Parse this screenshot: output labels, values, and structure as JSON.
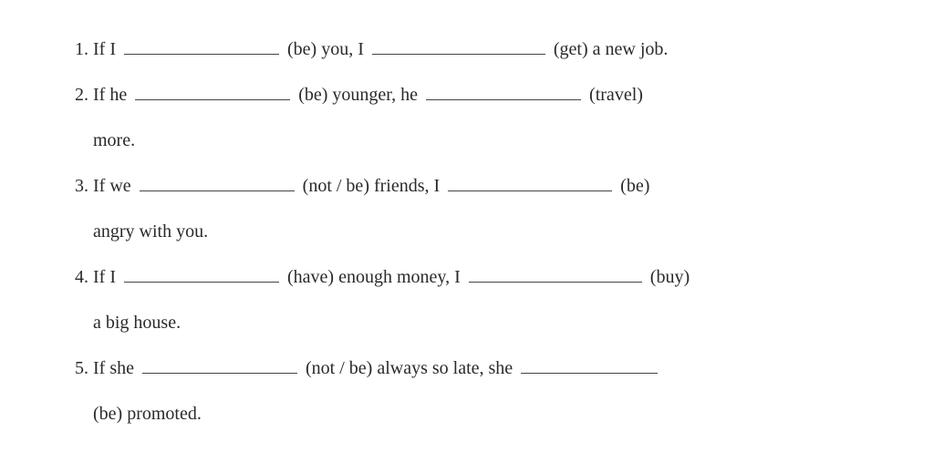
{
  "items": [
    {
      "parts": [
        {
          "t": "If I "
        },
        {
          "blank": "w170"
        },
        {
          "t": " (",
          "hint": "be",
          "after": ") you, I "
        },
        {
          "blank": "w190"
        },
        {
          "t": " (",
          "hint": "get",
          "after": ") a new job."
        }
      ]
    },
    {
      "parts": [
        {
          "t": "If he "
        },
        {
          "blank": "w170"
        },
        {
          "t": " (",
          "hint": "be",
          "after": ") younger, he "
        },
        {
          "blank": "w170"
        },
        {
          "t": " (",
          "hint": "travel",
          "after": ")"
        }
      ],
      "cont": "more."
    },
    {
      "parts": [
        {
          "t": "If we "
        },
        {
          "blank": "w170"
        },
        {
          "t": " (",
          "hint": "not / be",
          "after": ") friends, I "
        },
        {
          "blank": "w180"
        },
        {
          "t": " (",
          "hint": "be",
          "after": ")"
        }
      ],
      "cont": "angry with you."
    },
    {
      "parts": [
        {
          "t": "If I "
        },
        {
          "blank": "w170"
        },
        {
          "t": " (",
          "hint": "have",
          "after": ") enough money, I "
        },
        {
          "blank": "w190"
        },
        {
          "t": " (",
          "hint": "buy",
          "after": ")"
        }
      ],
      "cont": "a big house."
    },
    {
      "parts": [
        {
          "t": "If she "
        },
        {
          "blank": "w170"
        },
        {
          "t": " (",
          "hint": "not / be",
          "after": ") always so late, she "
        },
        {
          "blank": "w150"
        }
      ],
      "cont": "(be) promoted."
    }
  ]
}
